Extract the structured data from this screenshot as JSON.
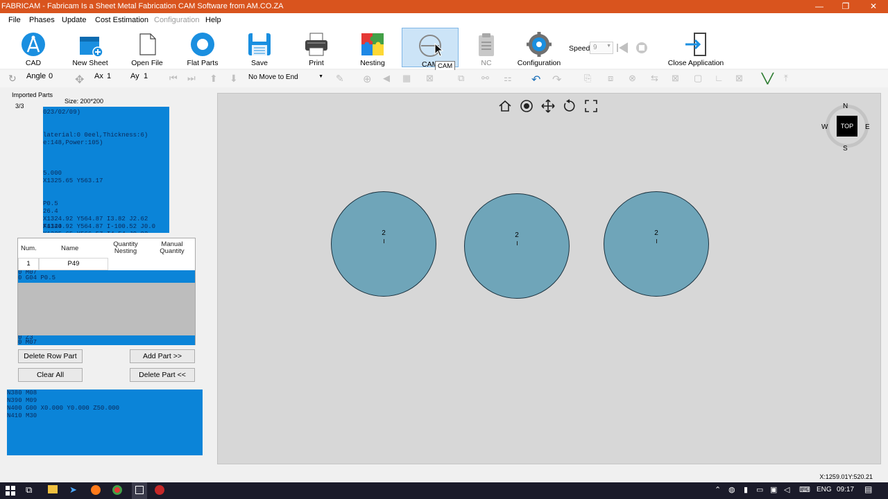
{
  "window": {
    "title": "FABRICAM - Fabricam Is a Sheet Metal Fabrication CAM Software from AM.CO.ZA",
    "controls": [
      "—",
      "❐",
      "✕"
    ]
  },
  "menu": {
    "file": "File",
    "phases": "Phases",
    "update": "Update",
    "cost_estimation": "Cost Estimation",
    "configuration": "Configuration",
    "help": "Help"
  },
  "ribbon": {
    "cad": "CAD",
    "new_sheet": "New Sheet",
    "open_file": "Open File",
    "flat_parts": "Flat Parts",
    "save": "Save",
    "print": "Print",
    "nesting": "Nesting",
    "cam": "CAM",
    "cam_tooltip": "CAM",
    "nc": "NC",
    "configuration": "Configuration",
    "speed_label": "Speed",
    "speed_value": "9",
    "close_application": "Close Application"
  },
  "toolbar2": {
    "angle_label": "Angle",
    "angle_value": "0",
    "ax_label": "Ax",
    "ax_value": "1",
    "ay_label": "Ay",
    "ay_value": "1",
    "move_select": "No Move to End"
  },
  "left_panel": {
    "imported_parts_label": "Imported Parts",
    "size_label": "Size: 200*200",
    "count": "3/3",
    "preview_lines": [
      "023/02/09)",
      "",
      "",
      "laterial:0   0eel,Thickness:6)",
      "e:148,Power:105)",
      "",
      "",
      "",
      "5.000",
      "X1325.65 Y563.17",
      "",
      "",
      "P0.5",
      "26.4",
      "X1324.92 Y564.87 I3.82 J2.62 F4140",
      "X1324.92 Y564.87 I-100.52 J0.0",
      "X1325.65 Y566.57 I4.54 J0.82"
    ],
    "grid": {
      "headers": {
        "num": "Num.",
        "name": "Name",
        "qty_nesting": "Quantity Nesting",
        "manual_qty": "Manual Quantity"
      },
      "row": {
        "num": "1",
        "name": "P49"
      },
      "blue_line": "0 G04 P0.5",
      "blue_top": "0 M07",
      "bottom_lines": [
        "0 Z3",
        "0 M07"
      ]
    },
    "buttons": {
      "delete_row": "Delete Row Part",
      "add_part": "Add Part >>",
      "clear_all": "Clear All",
      "delete_part": "Delete Part <<"
    },
    "nc_lines": [
      "N380 M08",
      "N390 M09",
      "N400 G00 X0.000 Y0.000 Z50.000",
      "N410 M30"
    ]
  },
  "canvas": {
    "parts": [
      {
        "label": "2"
      },
      {
        "label": "2"
      },
      {
        "label": "2"
      }
    ],
    "compass": {
      "n": "N",
      "s": "S",
      "e": "E",
      "w": "W",
      "center": "TOP"
    }
  },
  "status": {
    "coords": "X:1259.01Y:520.21"
  },
  "taskbar": {
    "lang": "ENG",
    "time": "09:17"
  },
  "colors": {
    "titlebar": "#d9541e",
    "blue_panel": "#0b84d8",
    "part_fill": "#6fa5b9",
    "canvas_bg": "#d7d7d7"
  }
}
